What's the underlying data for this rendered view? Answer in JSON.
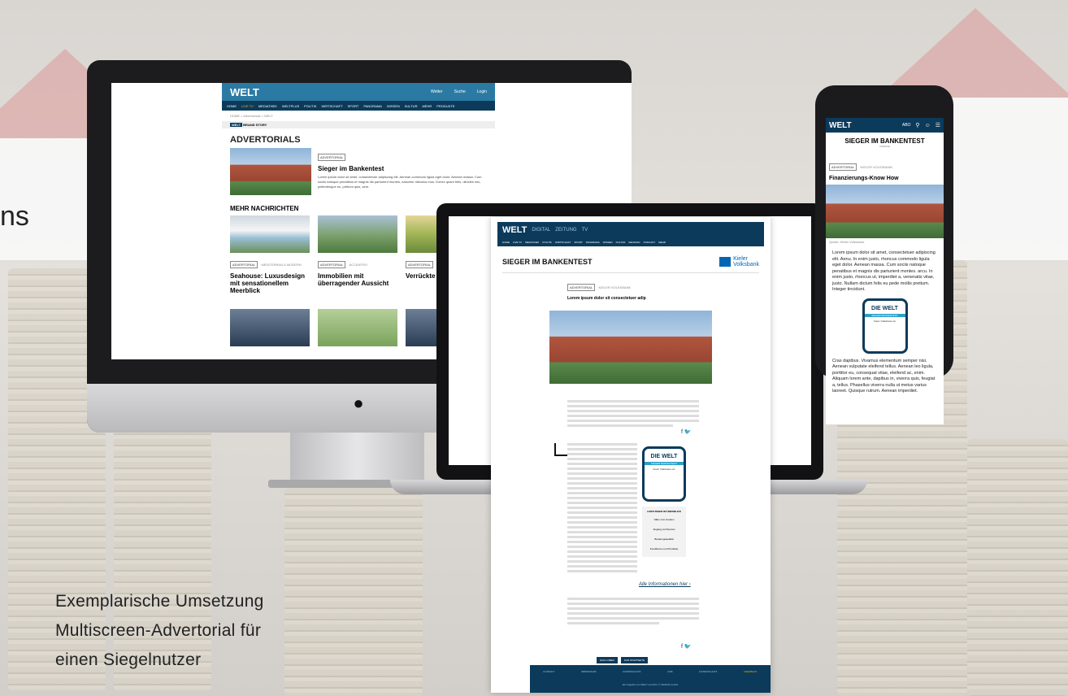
{
  "caption": {
    "line1": "Exemplarische Umsetzung",
    "line2": "Multiscreen-Advertorial für",
    "line3": "einen Siegelnutzer"
  },
  "partial_left_text": "ns",
  "desktop": {
    "logo": "WELT",
    "header_links": [
      "Wetter",
      "Suche",
      "Login"
    ],
    "nav": [
      "HOME",
      "LIVE TV",
      "MEDIATHEK",
      "WELTPLUS",
      "POLITIK",
      "WIRTSCHAFT",
      "SPORT",
      "PANORAMA",
      "WISSEN",
      "KULTUR",
      "MEHR",
      "PRODUKTE"
    ],
    "breadcrumb": "HOME > Advertorials > WELT",
    "brand_story": "BRAND STORY",
    "section_title": "ADVERTORIALS",
    "featured": {
      "tag": "ADVERTORIAL",
      "title": "Sieger im Bankentest",
      "text": "Lorem ipsum dolor sit amet, consectetuer adipiscing elit. Aenean commodo ligula eget dolor. Aenean massa. Cum sociis natoque penatibus et magnis dis parturient montes, nascetur ridiculus mus. Donec quam felis, ultricies nec, pellentesque eu, pretium quis, sem."
    },
    "more_title": "MEHR NACHRICHTEN",
    "cards": [
      {
        "tag": "ADVERTORIAL",
        "tag2": "MEDITERRAN & MODERN",
        "title": "Seahouse: Luxusdesign mit sensationellem Meerblick"
      },
      {
        "tag": "ADVERTORIAL",
        "tag2": "ACCENTRO",
        "title": "Immobilien mit überragender Aussicht"
      },
      {
        "tag": "ADVERTORIAL",
        "tag2": "",
        "title": "Verrückte Riesling-"
      }
    ]
  },
  "tablet": {
    "logo": "WELT",
    "logo_tabs": [
      "DIGITAL",
      "ZEITUNG",
      "TV"
    ],
    "nav": [
      "HOME",
      "LIVE TV",
      "MEDIATHEK",
      "POLITIK",
      "WIRTSCHAFT",
      "SPORT",
      "PANORAMA",
      "WISSEN",
      "KULTUR",
      "MEINUNG",
      "PODCAST",
      "MEHR"
    ],
    "header": "SIEGER IM BANKENTEST",
    "bank_name_line1": "Kieler",
    "bank_name_line2": "Volksbank",
    "tags": [
      "ADVERTORIAL",
      "KIELER VOLKSBANK"
    ],
    "headline": "Lorem ipsum dolor sit consectetuer adip",
    "info_link": "Alle Informationen hier ›",
    "seal": {
      "title": "DIE WELT",
      "line1": "SIEGER BANKENTEST",
      "line2": "Kieler Volksbank eG"
    },
    "seal_list_title": "LEISTUNGEN IM ÜBERBLICK",
    "seal_list": [
      "Nähe zum Kunden",
      "Zugang und Service",
      "Beratungsqualität",
      "Konditionen und Produkte"
    ],
    "buttons": [
      "NACH OBEN",
      "ZUR STARTSEITE"
    ],
    "footer_links": [
      "KONTAKT",
      "IMPRESSUM",
      "DATENSCHUTZ",
      "AGB",
      "DATENSCHUTZ",
      "FEEDBACK"
    ],
    "footer_note": "Ein Angebot von WELT und N24. © WeltN24 GmbH"
  },
  "phone": {
    "logo": "WELT",
    "header_label": "ABO",
    "title": "SIEGER IM BANKENTEST",
    "sub": "ANZEIGE",
    "tags": [
      "ADVERTORIAL",
      "KIELER VOLKSBANK"
    ],
    "headline": "Finanzierungs-Know How",
    "caption_small": "Quelle: Kieler Volksbank",
    "para1": "Lorem ipsum dolor sit amet, consectetuer adipiscing elit. Aenu. In enim justo, rhoncus commodo ligula eget dolor. Aenean massa. Cum sociis natoque penatibus et magnis dis parturient montes. arcu. In enim justo, rhoncus ut, imperdiet a, venenatis vitae, justo. Nullam dictum felis eu pede mollis pretium. Integer tincidunt.",
    "seal_title": "DIE WELT",
    "seal_line1": "SIEGER BANKENTEST",
    "seal_line2": "Kieler Volksbank eG",
    "para2": "Cras dapibus. Vivamus elementum semper nisi. Aenean vulputate eleifend tellus. Aenean leo ligula, porttitor eu, consequat vitae, eleifend ac, enim. Aliquam lorem ante, dapibus in, viverra quis, feugiat a, tellus. Phasellus viverra nulla ut metus varius laoreet. Quisque rutrum. Aenean imperdiet."
  }
}
